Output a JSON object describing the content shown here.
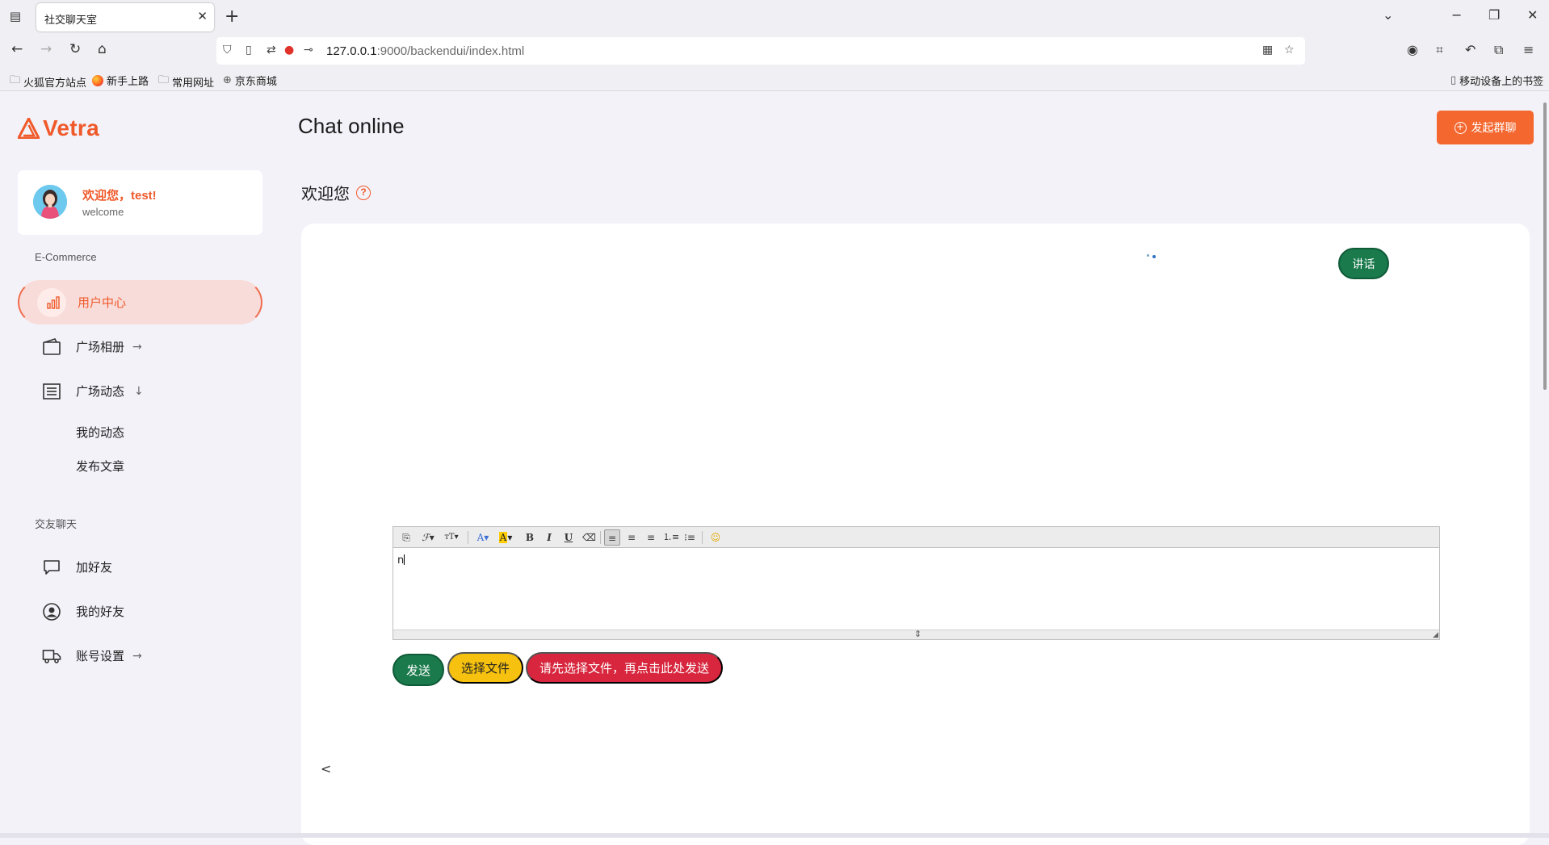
{
  "browser": {
    "tab_title": "社交聊天室",
    "url_host": "127.0.0.1",
    "url_rest": ":9000/backendui/index.html",
    "bookmarks": [
      "火狐官方站点",
      "新手上路",
      "常用网址",
      "京东商城"
    ],
    "mobile_bookmarks": "移动设备上的书签"
  },
  "sidebar": {
    "logo_text": "Vetra",
    "profile": {
      "greeting": "欢迎您，test!",
      "subtitle": "welcome"
    },
    "section_ecommerce": "E-Commerce",
    "section_chat": "交友聊天",
    "items": {
      "user_center": "用户中心",
      "album": "广场相册",
      "feed": "广场动态",
      "my_feed": "我的动态",
      "post_article": "发布文章",
      "add_friend": "加好友",
      "my_friends": "我的好友",
      "account_settings": "账号设置"
    }
  },
  "header": {
    "title": "Chat online",
    "group_chat_button": "发起群聊"
  },
  "main": {
    "welcome": "欢迎您",
    "talk_button": "讲话",
    "editor_text": "n",
    "send_button": "发送",
    "choose_file_button": "选择文件",
    "upload_button": "请先选择文件，再点击此处发送",
    "prev_arrow": "<"
  },
  "colors": {
    "accent": "#f05a2b",
    "send_green": "#1a7a4c",
    "file_yellow": "#f6c10f",
    "upload_red": "#d7263d",
    "active_bg": "#f8dcd9"
  }
}
